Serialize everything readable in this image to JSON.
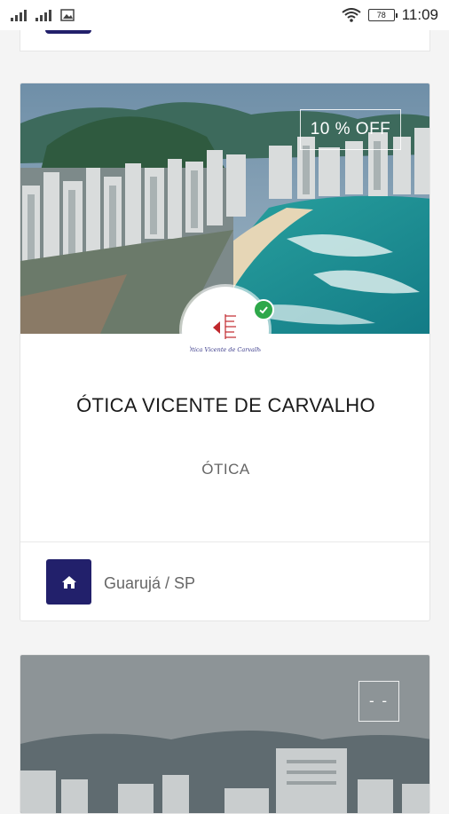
{
  "status_bar": {
    "time": "11:09",
    "battery": "78",
    "icons": [
      "signal-icon",
      "signal-icon",
      "image-icon",
      "wifi-icon",
      "battery-icon"
    ]
  },
  "listing": {
    "discount": "10 % OFF",
    "name": "ÓTICA VICENTE DE CARVALHO",
    "category": "ÓTICA",
    "location": "Guarujá / SP",
    "verified": true,
    "logo_caption": "Ótica Vicente de Carvalho"
  },
  "next_listing": {
    "discount": "- -"
  },
  "colors": {
    "accent": "#22206b",
    "verified": "#2ea84a"
  }
}
